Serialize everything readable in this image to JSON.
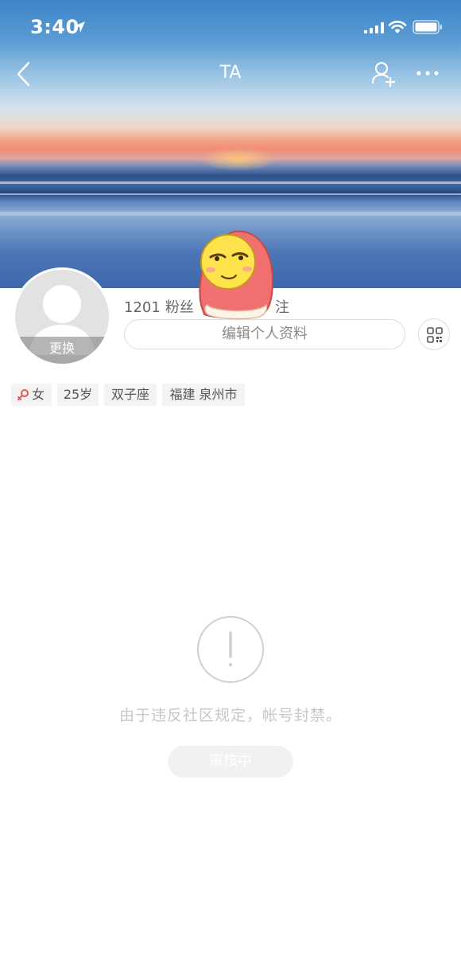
{
  "status_bar": {
    "time": "3:40"
  },
  "nav": {
    "title": "TA"
  },
  "profile": {
    "avatar_change_label": "更换",
    "followers_count": "1201",
    "followers_label": "粉丝",
    "following_suffix": "注",
    "edit_profile_label": "编辑个人资料"
  },
  "tags": {
    "gender": "女",
    "age": "25岁",
    "zodiac": "双子座",
    "location": "福建 泉州市"
  },
  "notice": {
    "message": "由于违反社区规定，帐号封禁。",
    "review_button_label": "审核中"
  },
  "colors": {
    "accent_female": "#e6555a",
    "muted_text": "#c7c7c7",
    "secondary_text": "#666666"
  },
  "icons": [
    "back-icon",
    "add-friend-icon",
    "more-icon",
    "qr-code-icon",
    "female-icon",
    "exclamation-icon",
    "location-arrow-icon",
    "signal-icon",
    "wifi-icon",
    "battery-icon"
  ]
}
